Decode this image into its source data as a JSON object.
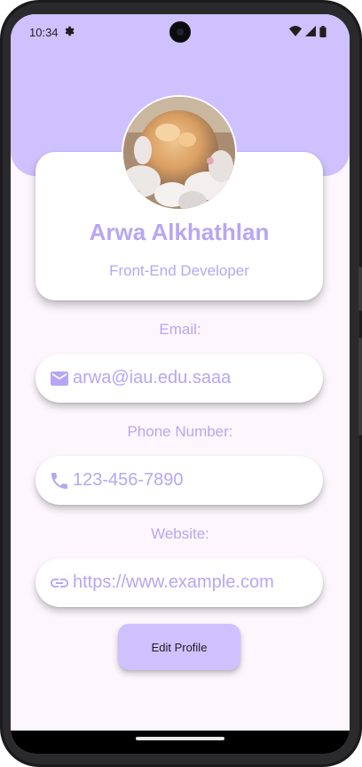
{
  "status_bar": {
    "time": "10:34",
    "icons": [
      "settings-gear-icon",
      "wifi-icon",
      "signal-icon",
      "battery-icon"
    ]
  },
  "profile": {
    "name": "Arwa Alkhathlan",
    "role": "Front-End Developer",
    "avatar": "cat-photo"
  },
  "fields": [
    {
      "label": "Email:",
      "icon": "email-icon",
      "value": "arwa@iau.edu.saaa"
    },
    {
      "label": "Phone Number:",
      "icon": "phone-icon",
      "value": "123-456-7890"
    },
    {
      "label": "Website:",
      "icon": "link-icon",
      "value": "https://www.example.com"
    }
  ],
  "actions": {
    "edit_profile_label": "Edit Profile"
  },
  "colors": {
    "accent": "#cfc1fe",
    "text_accent": "#b7a6f4",
    "background": "#fdf7fd"
  }
}
